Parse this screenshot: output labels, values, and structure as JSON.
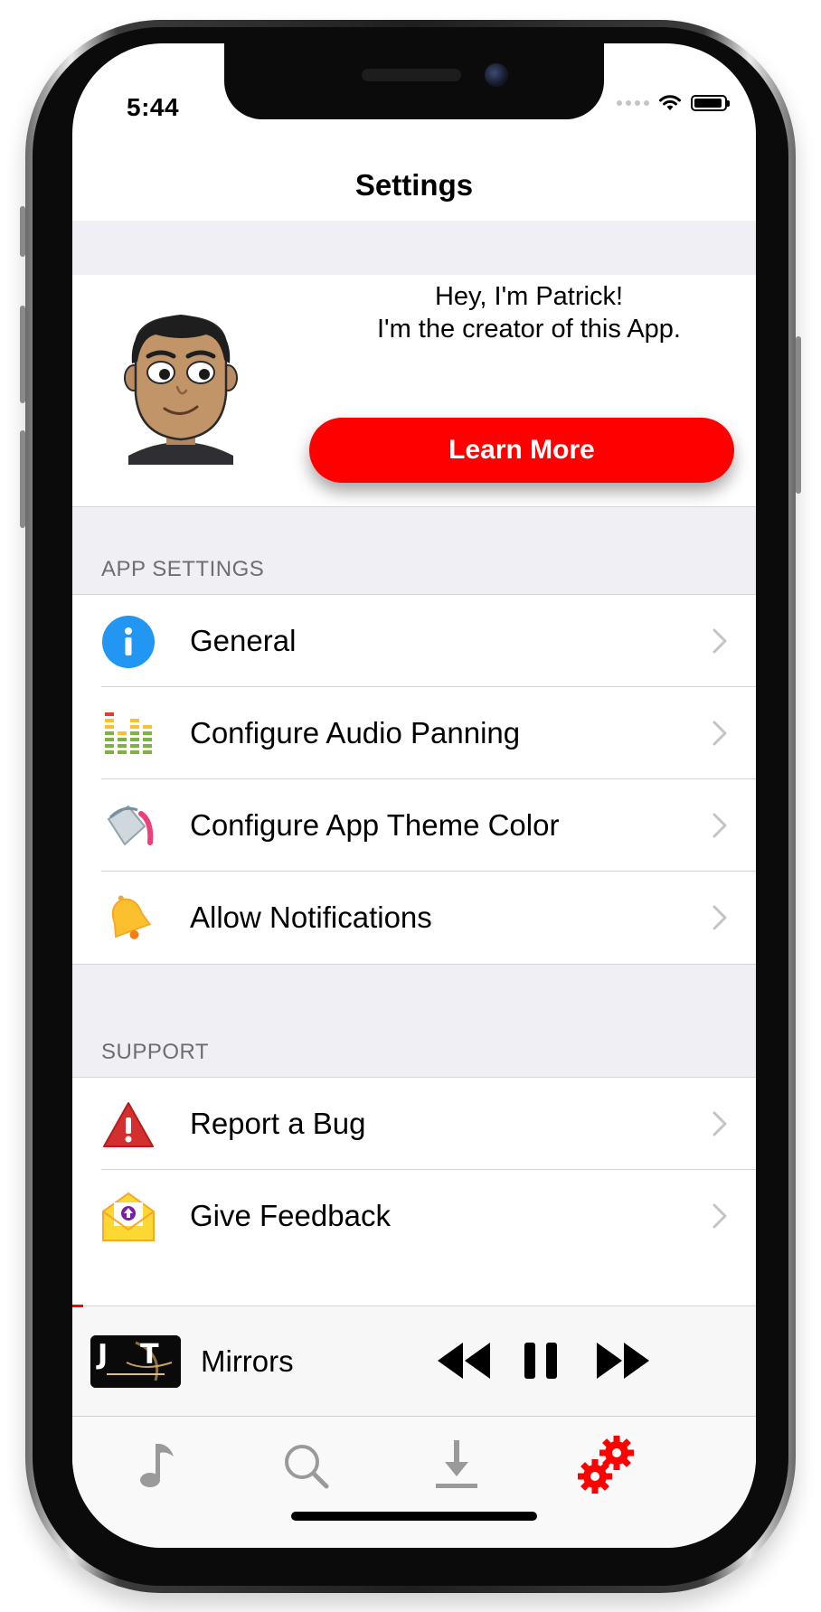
{
  "status_bar": {
    "time": "5:44"
  },
  "nav": {
    "title": "Settings"
  },
  "promo": {
    "line1": "Hey, I'm Patrick!",
    "line2": "I'm the creator of this App.",
    "button_label": "Learn More"
  },
  "sections": {
    "app_settings": {
      "header": "APP SETTINGS",
      "items": [
        {
          "label": "General",
          "icon": "info-icon"
        },
        {
          "label": "Configure Audio Panning",
          "icon": "equalizer-icon"
        },
        {
          "label": "Configure App Theme Color",
          "icon": "paint-bucket-icon"
        },
        {
          "label": "Allow Notifications",
          "icon": "bell-icon"
        }
      ]
    },
    "support": {
      "header": "SUPPORT",
      "items": [
        {
          "label": "Report a Bug",
          "icon": "warning-icon"
        },
        {
          "label": "Give Feedback",
          "icon": "feedback-envelope-icon"
        }
      ]
    }
  },
  "now_playing": {
    "title": "Mirrors",
    "artwork_text": "JT",
    "progress": 0.016
  },
  "tabs": [
    {
      "name": "music",
      "icon": "music-note-icon",
      "active": false
    },
    {
      "name": "search",
      "icon": "search-icon",
      "active": false
    },
    {
      "name": "downloads",
      "icon": "download-icon",
      "active": false
    },
    {
      "name": "settings",
      "icon": "gears-icon",
      "active": true
    }
  ],
  "colors": {
    "accent": "#ff0000",
    "group_background": "#efeff4",
    "section_header": "#6d6d72",
    "tab_inactive": "#9a9a9a"
  }
}
